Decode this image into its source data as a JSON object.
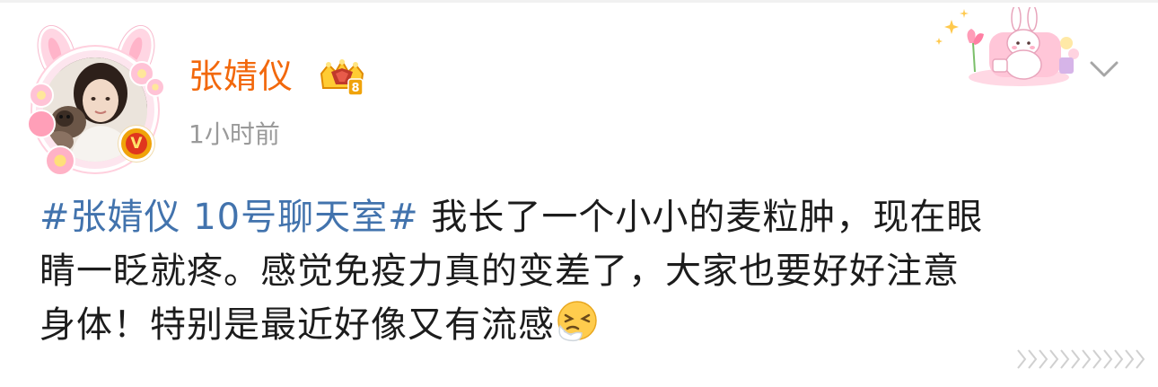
{
  "post": {
    "author": "张婧仪",
    "time": "1小时前",
    "hashtag": "#张婧仪 10号聊天室#",
    "text_line1": "我长了一个小小的麦粒肿，现在眼",
    "text_line2": "睛一眨就疼。感觉免疫力真的变差了，大家也要好好注意",
    "text_line3": "身体！特别是最近好像又有流感",
    "verified_badge": "V",
    "emoji": "sneezing-face",
    "icons": [
      "crown-member-icon",
      "chevron-down-icon",
      "bunny-decoration-icon",
      "expand-arrows-icon"
    ]
  },
  "colors": {
    "author": "#f2680c",
    "hashtag": "#4273ad",
    "timestamp": "#9a9a9a",
    "text": "#1c1c1c",
    "verified": "#f0a30a"
  }
}
